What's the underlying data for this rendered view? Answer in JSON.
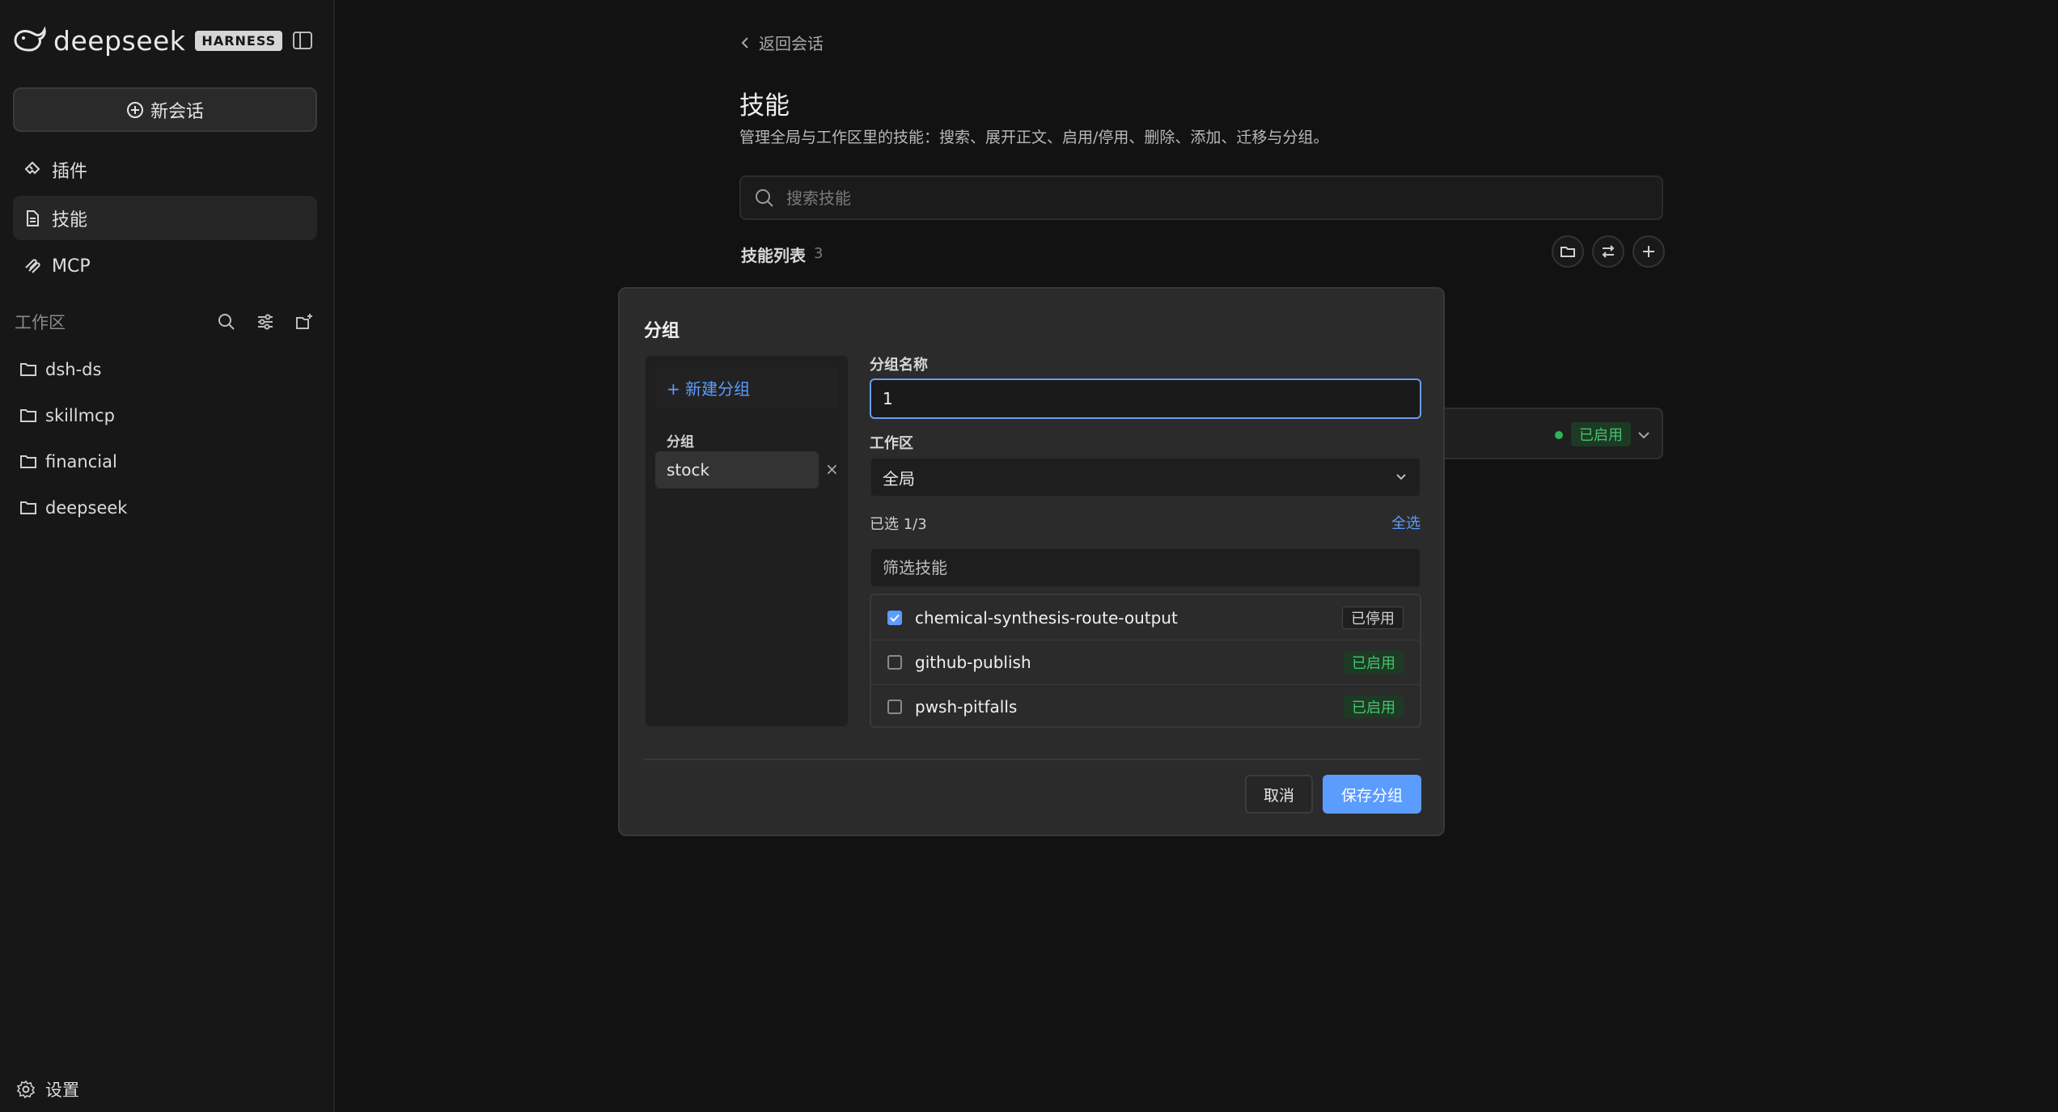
{
  "sidebar": {
    "brand_name": "deepseek",
    "brand_badge": "HARNESS",
    "new_chat_label": "新会话",
    "nav": [
      {
        "label": "插件",
        "icon": "plugin-icon"
      },
      {
        "label": "技能",
        "icon": "document-icon",
        "active": true
      },
      {
        "label": "MCP",
        "icon": "mcp-icon"
      }
    ],
    "workspace_label": "工作区",
    "workspace_tools": [
      "search-icon",
      "filter-icon",
      "new-folder-icon"
    ],
    "folders": [
      "dsh-ds",
      "skillmcp",
      "financial",
      "deepseek"
    ],
    "settings_label": "设置"
  },
  "main": {
    "back_label": "返回会话",
    "title": "技能",
    "description": "管理全局与工作区里的技能：搜索、展开正文、启用/停用、删除、添加、迁移与分组。",
    "search_placeholder": "搜索技能",
    "list_title": "技能列表",
    "list_count": "3",
    "list_actions": [
      "folder-icon",
      "swap-icon",
      "plus-icon"
    ],
    "background_row_status": "已启用"
  },
  "modal": {
    "title": "分组",
    "new_group_label": "+ 新建分组",
    "groups_label": "分组",
    "groups": [
      "stock"
    ],
    "remove_symbol": "×",
    "name_label": "分组名称",
    "name_value": "1",
    "workspace_label": "工作区",
    "workspace_value": "全局",
    "selected_count": "已选 1/3",
    "select_all": "全选",
    "filter_placeholder": "筛选技能",
    "skills": [
      {
        "name": "chemical-synthesis-route-output",
        "checked": true,
        "status": "已停用",
        "enabled": false
      },
      {
        "name": "github-publish",
        "checked": false,
        "status": "已启用",
        "enabled": true
      },
      {
        "name": "pwsh-pitfalls",
        "checked": false,
        "status": "已启用",
        "enabled": true
      }
    ],
    "cancel_label": "取消",
    "save_label": "保存分组"
  },
  "colors": {
    "accent": "#5b9cff",
    "enabled_text": "#44c46b",
    "enabled_bg": "#1d3a25"
  }
}
